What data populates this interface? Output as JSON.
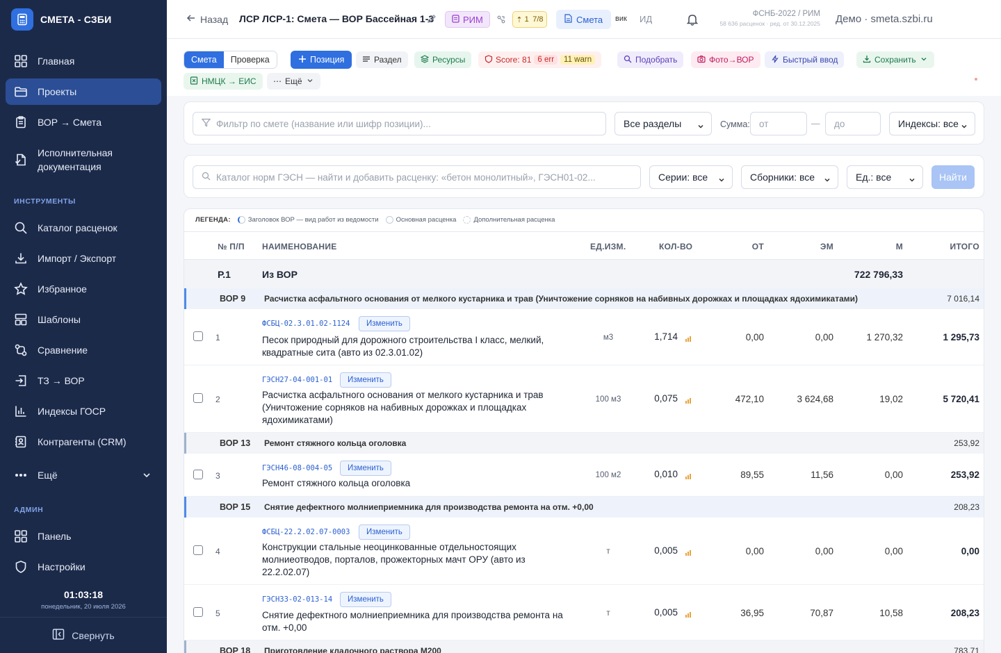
{
  "brand": {
    "title": "СМЕТА - СЗБИ"
  },
  "sidebar": {
    "main": [
      {
        "label": "Главная",
        "icon": "grid-icon"
      },
      {
        "label": "Проекты",
        "icon": "folder-icon",
        "active": true
      },
      {
        "label": "ВОР → Смета",
        "icon": "clipboard-icon"
      },
      {
        "label": "Исполнительная документация",
        "line1": "Исполнительная",
        "line2": "документация",
        "icon": "doc-sign-icon"
      }
    ],
    "tools_title": "ИНСТРУМЕНТЫ",
    "tools": [
      {
        "label": "Каталог расценок",
        "icon": "search-icon"
      },
      {
        "label": "Импорт / Экспорт",
        "icon": "download-icon"
      },
      {
        "label": "Избранное",
        "icon": "star-icon"
      },
      {
        "label": "Шаблоны",
        "icon": "template-icon"
      },
      {
        "label": "Сравнение",
        "icon": "compare-icon"
      },
      {
        "label": "ТЗ → ВОР",
        "icon": "import-icon"
      },
      {
        "label": "Индексы ГОСР",
        "icon": "bar-chart-icon"
      },
      {
        "label": "Контрагенты (CRM)",
        "icon": "contacts-icon"
      },
      {
        "label": "Ещё",
        "icon": "more-icon"
      }
    ],
    "admin_title": "АДМИН",
    "admin": [
      {
        "label": "Панель",
        "icon": "grid-icon"
      },
      {
        "label": "Настройки",
        "icon": "shield-icon"
      }
    ],
    "clock_time": "01:03:18",
    "clock_date": "понедельник, 20 июля 2026",
    "collapse_label": "Свернуть"
  },
  "header": {
    "back_label": "Назад",
    "title": "ЛСР ЛСР-1: Смета — ВОР Бассейная 1-3",
    "rim_badge": "РИМ",
    "gold_badge": "1 7/8",
    "smeta_tab": "Смета",
    "vik_label": "вик",
    "id_label": "ИД",
    "fsnb_line1": "ФСНБ-2022 / РИМ",
    "fsnb_line2": "58 636 расценок · ред. от 30.12.2025",
    "demo_label": "Демо · smeta.szbi.ru"
  },
  "toolbar": {
    "seg_smeta": "Смета",
    "seg_check": "Проверка",
    "add_position": "Позиция",
    "section": "Раздел",
    "resources": "Ресурсы",
    "score_label": "Score: 81",
    "err_label": "6 err",
    "warn_label": "11 warn",
    "pick": "Подобрать",
    "photo": "Фото→ВОР",
    "quick": "Быстрый ввод",
    "save": "Сохранить",
    "nmck": "НМЦК → ЕИС",
    "more": "Ещё"
  },
  "filter": {
    "placeholder": "Фильтр по смете (название или шифр позиции)...",
    "sections_select": "Все разделы",
    "sum_label": "Сумма:",
    "from_placeholder": "от",
    "dash": "—",
    "to_placeholder": "до",
    "index_select": "Индексы: все"
  },
  "catalog": {
    "placeholder": "Каталог норм ГЭСН — найти и добавить расценку: «бетон монолитный», ГЭСН01-02...",
    "series": "Серии: все",
    "collections": "Сборники: все",
    "units": "Ед.: все",
    "find_button": "Найти"
  },
  "legend": {
    "title": "ЛЕГЕНДА:",
    "item1": "Заголовок ВОР — вид работ из ведомости",
    "item2": "Основная расценка",
    "item3": "Дополнительная расценка"
  },
  "columns": {
    "num": "№ П/П",
    "name": "НАИМЕНОВАНИЕ",
    "unit": "ЕД.ИЗМ.",
    "qty": "КОЛ-ВО",
    "ot": "ОТ",
    "em": "ЭМ",
    "m": "М",
    "total": "ИТОГО"
  },
  "section_row": {
    "code": "Р.1",
    "title": "Из ВОР",
    "sum": "722 796,33"
  },
  "vor_groups": [
    {
      "num": "ВОР 9",
      "title": "Расчистка асфальтного основания от мелкого кустарника и трав (Уничтожение сорняков на набивных дорожках и площадках ядохимикатами)",
      "sum": "7 016,14"
    },
    {
      "num": "ВОР 13",
      "title": "Ремонт стяжного кольца оголовка",
      "sum": "253,92"
    },
    {
      "num": "ВОР 15",
      "title": "Снятие дефектного молниеприемника для производства ремонта на отм. +0,00",
      "sum": "208,23"
    },
    {
      "num": "ВОР 18",
      "title": "Приготовление кладочного раствора М200",
      "sum": "783,71"
    }
  ],
  "change_label": "Изменить",
  "rows": [
    {
      "num": "1",
      "code": "ФСБЦ-02.3.01.02-1124",
      "name": "Песок природный для дорожного строительства I класс, мелкий, квадратные сита (авто из 02.3.01.02)",
      "unit": "м3",
      "qty": "1,714",
      "ot": "0,00",
      "em": "0,00",
      "m": "1 270,32",
      "total": "1 295,73"
    },
    {
      "num": "2",
      "code": "ГЭСН27-04-001-01",
      "name": "Расчистка асфальтного основания от мелкого кустарника и трав (Уничтожение сорняков на набивных дорожках и площадках ядохимикатами)",
      "unit": "100 м3",
      "qty": "0,075",
      "ot": "472,10",
      "em": "3 624,68",
      "m": "19,02",
      "total": "5 720,41"
    },
    {
      "num": "3",
      "code": "ГЭСН46-08-004-05",
      "name": "Ремонт стяжного кольца оголовка",
      "unit": "100 м2",
      "qty": "0,010",
      "ot": "89,55",
      "em": "11,56",
      "m": "0,00",
      "total": "253,92"
    },
    {
      "num": "4",
      "code": "ФСБЦ-22.2.02.07-0003",
      "name": "Конструкции стальные неоцинкованные отдельностоящих молниеотводов, порталов, прожекторных мачт ОРУ (авто из 22.2.02.07)",
      "unit": "т",
      "qty": "0,005",
      "ot": "0,00",
      "em": "0,00",
      "m": "0,00",
      "total": "0,00"
    },
    {
      "num": "5",
      "code": "ГЭСН33-02-013-14",
      "name": "Снятие дефектного молниеприемника для производства ремонта на отм. +0,00",
      "unit": "т",
      "qty": "0,005",
      "ot": "36,95",
      "em": "70,87",
      "m": "10,58",
      "total": "208,23"
    }
  ]
}
